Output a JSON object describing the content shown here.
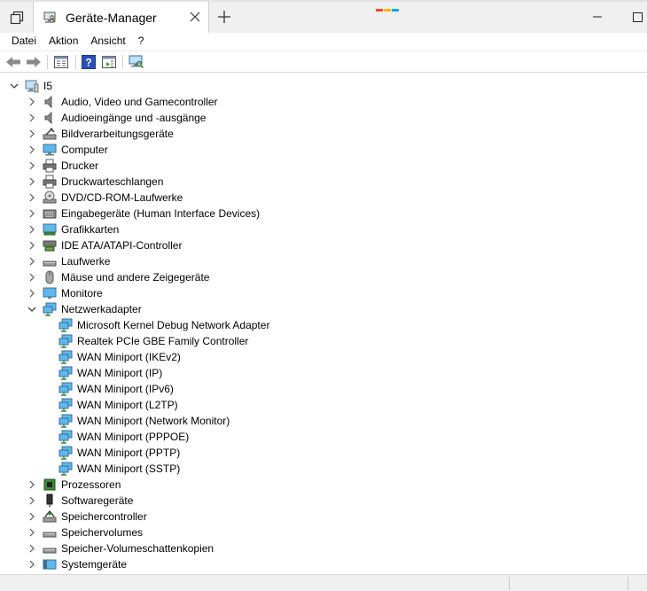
{
  "window": {
    "tab_title": "Geräte-Manager",
    "new_tab_symbol": "+",
    "accent_colors": [
      "#f25022",
      "#ffb900",
      "#00a4ef"
    ]
  },
  "menu": {
    "items": [
      {
        "label": "Datei"
      },
      {
        "label": "Aktion"
      },
      {
        "label": "Ansicht"
      },
      {
        "label": "?"
      }
    ]
  },
  "toolbar": {
    "buttons": [
      {
        "icon": "back-arrow-icon"
      },
      {
        "icon": "forward-arrow-icon"
      },
      {
        "icon": "properties-icon"
      },
      {
        "icon": "help-icon"
      },
      {
        "icon": "details-pane-icon"
      },
      {
        "icon": "scan-hardware-icon"
      }
    ]
  },
  "tree": {
    "root": {
      "label": "I5",
      "expanded": true
    },
    "categories": [
      {
        "label": "Audio, Video und Gamecontroller",
        "icon": "speaker-icon",
        "expanded": false
      },
      {
        "label": "Audioeingänge und -ausgänge",
        "icon": "speaker-icon",
        "expanded": false
      },
      {
        "label": "Bildverarbeitungsgeräte",
        "icon": "camera-icon",
        "expanded": false
      },
      {
        "label": "Computer",
        "icon": "computer-icon",
        "expanded": false
      },
      {
        "label": "Drucker",
        "icon": "printer-icon",
        "expanded": false
      },
      {
        "label": "Druckwarteschlangen",
        "icon": "printer-icon",
        "expanded": false
      },
      {
        "label": "DVD/CD-ROM-Laufwerke",
        "icon": "disc-drive-icon",
        "expanded": false
      },
      {
        "label": "Eingabegeräte (Human Interface Devices)",
        "icon": "keyboard-icon",
        "expanded": false
      },
      {
        "label": "Grafikkarten",
        "icon": "display-adapter-icon",
        "expanded": false
      },
      {
        "label": "IDE ATA/ATAPI-Controller",
        "icon": "ide-controller-icon",
        "expanded": false
      },
      {
        "label": "Laufwerke",
        "icon": "disk-drive-icon",
        "expanded": false
      },
      {
        "label": "Mäuse und andere Zeigegeräte",
        "icon": "mouse-icon",
        "expanded": false
      },
      {
        "label": "Monitore",
        "icon": "monitor-icon",
        "expanded": false
      },
      {
        "label": "Netzwerkadapter",
        "icon": "network-adapter-icon",
        "expanded": true,
        "children": [
          {
            "label": "Microsoft Kernel Debug Network Adapter"
          },
          {
            "label": "Realtek PCIe GBE Family Controller"
          },
          {
            "label": "WAN Miniport (IKEv2)"
          },
          {
            "label": "WAN Miniport (IP)"
          },
          {
            "label": "WAN Miniport (IPv6)"
          },
          {
            "label": "WAN Miniport (L2TP)"
          },
          {
            "label": "WAN Miniport (Network Monitor)"
          },
          {
            "label": "WAN Miniport (PPPOE)"
          },
          {
            "label": "WAN Miniport (PPTP)"
          },
          {
            "label": "WAN Miniport (SSTP)"
          }
        ]
      },
      {
        "label": "Prozessoren",
        "icon": "processor-icon",
        "expanded": false
      },
      {
        "label": "Softwaregeräte",
        "icon": "software-device-icon",
        "expanded": false
      },
      {
        "label": "Speichercontroller",
        "icon": "storage-controller-icon",
        "expanded": false
      },
      {
        "label": "Speichervolumes",
        "icon": "disk-drive-icon",
        "expanded": false
      },
      {
        "label": "Speicher-Volumeschattenkopien",
        "icon": "disk-drive-icon",
        "expanded": false
      },
      {
        "label": "Systemgeräte",
        "icon": "system-device-icon",
        "expanded": false
      }
    ]
  }
}
